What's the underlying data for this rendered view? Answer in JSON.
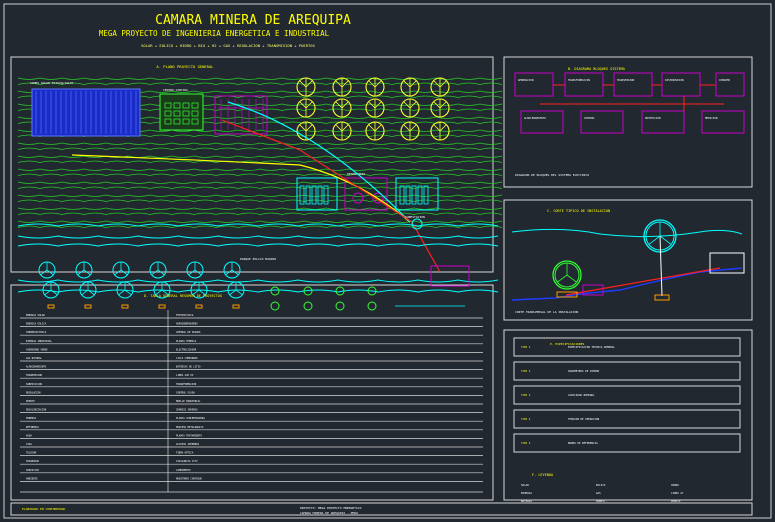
{
  "sheet": {
    "title": "CAMARA MINERA DE AREQUIPA",
    "subtitle": "MEGA PROYECTO DE INGENIERIA ENERGETICA E INDUSTRIAL",
    "tagline": "SOLAR + EOLICO + HIDRO + BIO + H2 + GAS + REGULACION + TRANSMISION + PUERTOS"
  },
  "colors": {
    "background": "#212830",
    "title": "#ffff00",
    "solar": "#1e3cff",
    "hills": "#28c828",
    "water": "#00ffff",
    "purple": "#c800c8",
    "red": "#ff2020",
    "panel_border": "#d8d8d8"
  },
  "panels": {
    "plan": {
      "title": "A. PLANO PROYECTO GENERAL",
      "label_solar": "CAMPO SOLAR FOTOVOLTAICO",
      "label_center": "CENTRO CONTROL",
      "label_reservoir": "RESERVORIO",
      "label_offshore": "PARQUE EOLICO MARINO",
      "label_substation": "SUBESTACION"
    },
    "block_diagram": {
      "title": "B. DIAGRAMA BLOQUES SISTEMA",
      "note": "DIAGRAMA DE BLOQUES DEL SISTEMA ELECTRICO"
    },
    "section": {
      "title": "C. CORTE TIPICO DE INSTALACION",
      "note": "CORTE TRANSVERSAL DE LA INSTALACION"
    },
    "table": {
      "title": "D. TABLA GENERAL RESUMEN DE PROYECTOS"
    },
    "specs": {
      "title": "E. ESPECIFICACIONES",
      "items": [
        "TIPO 1",
        "TIPO 2",
        "TIPO 3",
        "TIPO 4",
        "TIPO 5"
      ],
      "descriptions": [
        "ESPECIFICACION TECNICA GENERAL",
        "PARAMETROS DE DISENO",
        "CAPACIDAD NOMINAL",
        "TENSION DE OPERACION",
        "NORMA DE REFERENCIA"
      ]
    },
    "legend": {
      "title": "F. LEYENDA",
      "rows": [
        [
          "SOLAR",
          "EOLICO",
          "HIDRO"
        ],
        [
          "BIOMASA",
          "GAS",
          "LINEA AT"
        ],
        [
          "BATERIA",
          "SUBEST.",
          "PUERTO"
        ]
      ]
    }
  },
  "blocks": {
    "top": [
      "GENERACION",
      "TRANSFORMACION",
      "TRANSMISION",
      "DISTRIBUCION",
      "CONSUMO"
    ],
    "bottom": [
      "ALMACENAMIENTO",
      "CONTROL",
      "PROTECCION",
      "MEDICION"
    ]
  },
  "table_rows": [
    [
      "ENERGIA SOLAR",
      "FOTOVOLTAICA"
    ],
    [
      "ENERGIA EOLICA",
      "AEROGENERADORES"
    ],
    [
      "HIDROELECTRICA",
      "CENTRAL DE PASADA"
    ],
    [
      "BIOMASA INDUSTRIAL",
      "PLANTA TERMICA"
    ],
    [
      "HIDROGENO VERDE",
      "ELECTROLIZADOR"
    ],
    [
      "GAS NATURAL",
      "CICLO COMBINADO"
    ],
    [
      "ALMACENAMIENTO",
      "BATERIAS DE LITIO"
    ],
    [
      "TRANSMISION",
      "LINEA 220 KV"
    ],
    [
      "SUBESTACION",
      "TRANSFORMACION"
    ],
    [
      "REGULACION",
      "CONTROL SCADA"
    ],
    [
      "PUERTO",
      "MUELLE INDUSTRIAL"
    ],
    [
      "DESALINIZACION",
      "OSMOSIS INVERSA"
    ],
    [
      "MINERIA",
      "PLANTA CONCENTRADORA"
    ],
    [
      "REFINERIA",
      "PROCESO METALURGICO"
    ],
    [
      "AGUA",
      "PLANTA TRATAMIENTO"
    ],
    [
      "VIAS",
      "ACCESOS INTERNOS"
    ],
    [
      "TELECOM.",
      "FIBRA OPTICA"
    ],
    [
      "SEGURIDAD",
      "VIGILANCIA CCTV"
    ],
    [
      "SERVICIOS",
      "CAMPAMENTO"
    ],
    [
      "AMBIENTE",
      "MONITOREO CONTINUO"
    ]
  ],
  "footer": {
    "left": "ELABORADO EN CONFORMIDAD",
    "center1": "PROYECTO: MEGA PROYECTO ENERGETICO",
    "center2": "CAMARA MINERA DE AREQUIPA - PERU"
  }
}
